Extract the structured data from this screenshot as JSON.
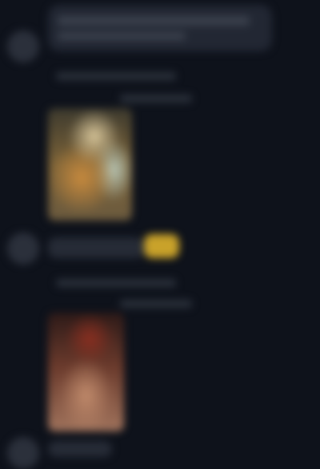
{
  "colors": {
    "background": "#0e121b",
    "bubble": "#222733",
    "avatar": "#2b303b",
    "accent_gold": "#c9a22a"
  },
  "messages": [
    {
      "avatar": "avatar-icon",
      "text_lines": [
        "",
        ""
      ],
      "has_bubble": true
    },
    {
      "avatar": "avatar-icon",
      "image": "photo-thumbnail",
      "meta_lines": [
        "",
        ""
      ],
      "badge": "gold-badge"
    },
    {
      "avatar": "avatar-icon",
      "image": "photo-thumbnail",
      "meta_lines": [
        "",
        ""
      ]
    }
  ]
}
